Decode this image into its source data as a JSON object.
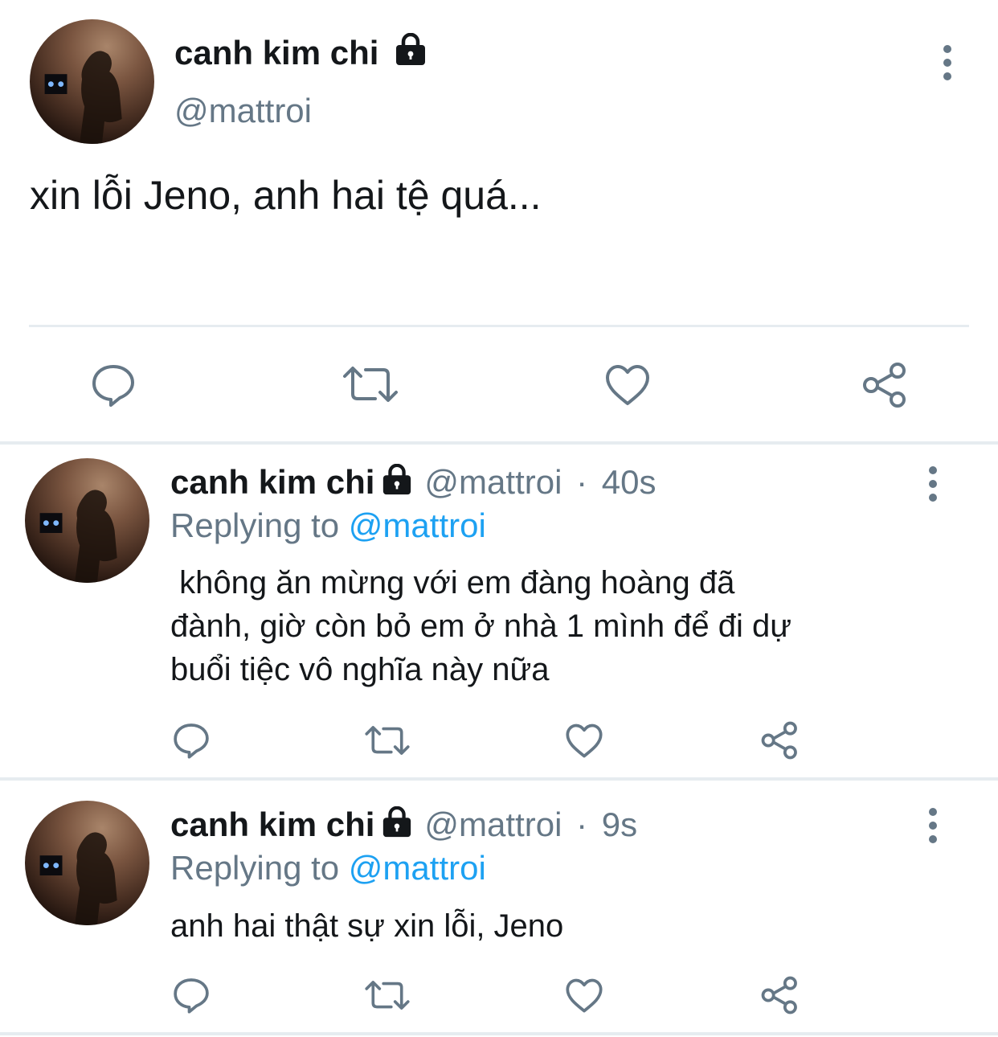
{
  "main_tweet": {
    "display_name": "canh kim chi",
    "handle": "@mattroi",
    "text": "xin lỗi Jeno, anh hai tệ quá...",
    "icons": {
      "protected": "lock-icon",
      "more": "more-vertical-icon",
      "actions": [
        "reply-icon",
        "retweet-icon",
        "like-icon",
        "share-icon"
      ]
    }
  },
  "replies": [
    {
      "display_name": "canh kim chi",
      "handle": "@mattroi",
      "separator": "·",
      "time": "40s",
      "replying_prefix": "Replying to",
      "replying_to": "@mattroi",
      "text": " không ăn mừng với em đàng hoàng đã\nđành, giờ còn bỏ em ở nhà 1 mình để đi dự\nbuổi tiệc vô nghĩa này nữa"
    },
    {
      "display_name": "canh kim chi",
      "handle": "@mattroi",
      "separator": "·",
      "time": "9s",
      "replying_prefix": "Replying to",
      "replying_to": "@mattroi",
      "text": "anh hai thật sự xin lỗi, Jeno"
    }
  ],
  "colors": {
    "text": "#14171a",
    "secondary": "#657786",
    "link": "#1da1f2",
    "divider": "#e6ecf0"
  }
}
